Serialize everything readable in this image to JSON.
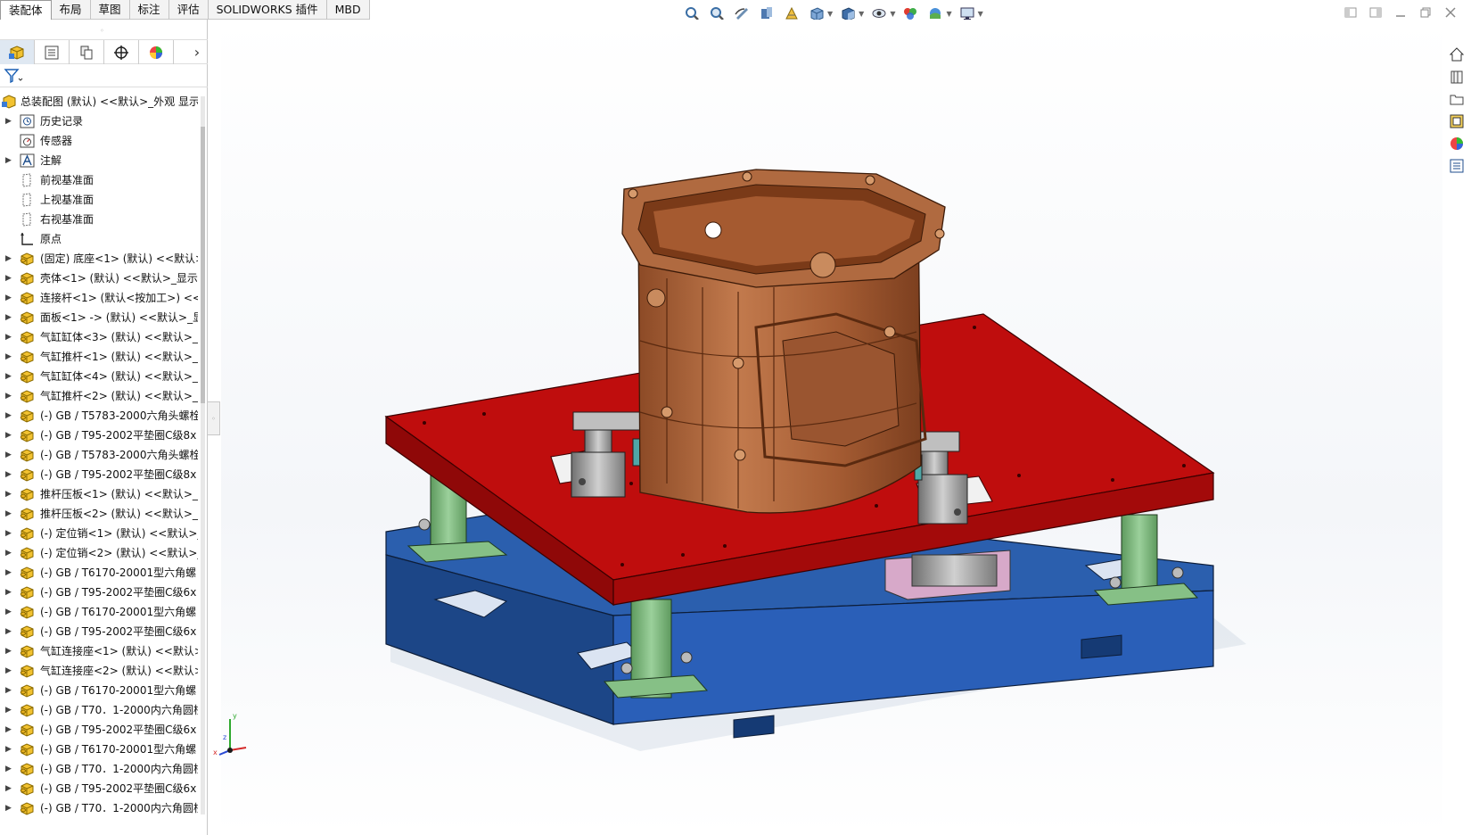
{
  "ribbon": {
    "tabs": [
      "装配体",
      "布局",
      "草图",
      "标注",
      "评估",
      "SOLIDWORKS 插件",
      "MBD"
    ],
    "active_tab": "装配体"
  },
  "heads_up_toolbar": {
    "icons": [
      "zoom-to-fit-icon",
      "zoom-to-area-icon",
      "previous-view-icon",
      "section-view-icon",
      "dynamic-annotation-icon",
      "view-orientation-icon",
      "display-style-icon",
      "hide-show-items-icon",
      "edit-appearance-icon",
      "apply-scene-icon",
      "view-settings-icon"
    ]
  },
  "window_controls": [
    "tile-left-icon",
    "tile-right-icon",
    "minimize-icon",
    "restore-icon",
    "close-icon"
  ],
  "feature_manager": {
    "panel_tabs": [
      "featuremanager-tree-icon",
      "propertymanager-icon",
      "configurationmanager-icon",
      "dimxpertmanager-icon",
      "displaymanager-icon"
    ],
    "root": "总装配图 (默认) <<默认>_外观 显示",
    "items": [
      {
        "label": "历史记录",
        "icon": "history-icon",
        "expandable": true
      },
      {
        "label": "传感器",
        "icon": "sensor-icon",
        "expandable": false
      },
      {
        "label": "注解",
        "icon": "annotation-icon",
        "expandable": true
      },
      {
        "label": "前视基准面",
        "icon": "plane-icon",
        "expandable": false
      },
      {
        "label": "上视基准面",
        "icon": "plane-icon",
        "expandable": false
      },
      {
        "label": "右视基准面",
        "icon": "plane-icon",
        "expandable": false
      },
      {
        "label": "原点",
        "icon": "origin-icon",
        "expandable": false
      },
      {
        "label": "(固定) 底座<1> (默认) <<默认>",
        "icon": "part-icon",
        "expandable": true
      },
      {
        "label": "壳体<1> (默认) <<默认>_显示",
        "icon": "part-icon",
        "expandable": true
      },
      {
        "label": "连接杆<1> (默认<按加工>) <<",
        "icon": "part-icon",
        "expandable": true
      },
      {
        "label": "面板<1> -> (默认) <<默认>_显",
        "icon": "part-icon",
        "expandable": true
      },
      {
        "label": "气缸缸体<3> (默认) <<默认>_显",
        "icon": "part-icon",
        "expandable": true
      },
      {
        "label": "气缸推杆<1> (默认) <<默认>_显",
        "icon": "part-icon",
        "expandable": true
      },
      {
        "label": "气缸缸体<4> (默认) <<默认>_显",
        "icon": "part-icon",
        "expandable": true
      },
      {
        "label": "气缸推杆<2> (默认) <<默认>_显",
        "icon": "part-icon",
        "expandable": true
      },
      {
        "label": "(-) GB / T5783-2000六角头螺栓",
        "icon": "part-icon",
        "expandable": true
      },
      {
        "label": "(-) GB / T95-2002平垫圈C级8x",
        "icon": "part-icon",
        "expandable": true
      },
      {
        "label": "(-) GB / T5783-2000六角头螺栓",
        "icon": "part-icon",
        "expandable": true
      },
      {
        "label": "(-) GB / T95-2002平垫圈C级8x",
        "icon": "part-icon",
        "expandable": true
      },
      {
        "label": "推杆压板<1> (默认) <<默认>_显",
        "icon": "part-icon",
        "expandable": true
      },
      {
        "label": "推杆压板<2> (默认) <<默认>_显",
        "icon": "part-icon",
        "expandable": true
      },
      {
        "label": "(-) 定位销<1> (默认) <<默认>_",
        "icon": "part-icon",
        "expandable": true
      },
      {
        "label": "(-) 定位销<2> (默认) <<默认>_",
        "icon": "part-icon",
        "expandable": true
      },
      {
        "label": "(-) GB / T6170-20001型六角螺",
        "icon": "part-icon",
        "expandable": true
      },
      {
        "label": "(-) GB / T95-2002平垫圈C级6x",
        "icon": "part-icon",
        "expandable": true
      },
      {
        "label": "(-) GB / T6170-20001型六角螺",
        "icon": "part-icon",
        "expandable": true
      },
      {
        "label": "(-) GB / T95-2002平垫圈C级6x",
        "icon": "part-icon",
        "expandable": true
      },
      {
        "label": "气缸连接座<1> (默认) <<默认>",
        "icon": "part-icon",
        "expandable": true
      },
      {
        "label": "气缸连接座<2> (默认) <<默认>",
        "icon": "part-icon",
        "expandable": true
      },
      {
        "label": "(-) GB / T6170-20001型六角螺",
        "icon": "part-icon",
        "expandable": true
      },
      {
        "label": "(-) GB / T70．1-2000内六角圆柱",
        "icon": "part-icon",
        "expandable": true
      },
      {
        "label": "(-) GB / T95-2002平垫圈C级6x",
        "icon": "part-icon",
        "expandable": true
      },
      {
        "label": "(-) GB / T6170-20001型六角螺",
        "icon": "part-icon",
        "expandable": true
      },
      {
        "label": "(-) GB / T70．1-2000内六角圆柱",
        "icon": "part-icon",
        "expandable": true
      },
      {
        "label": "(-) GB / T95-2002平垫圈C级6x",
        "icon": "part-icon",
        "expandable": true
      },
      {
        "label": "(-) GB / T70．1-2000内六角圆柱",
        "icon": "part-icon",
        "expandable": true
      }
    ]
  },
  "task_pane": [
    "solidworks-resources-icon",
    "design-library-icon",
    "file-explorer-icon",
    "view-palette-icon",
    "appearances-icon",
    "custom-properties-icon"
  ],
  "triad": {
    "x": "x",
    "y": "y",
    "z": "z"
  },
  "colors": {
    "top_plate": "#c00000",
    "base_plate": "#1f52a0",
    "pillars": "#7fb37f",
    "housing": "#b5663c",
    "cylinders": "#9a9a9a"
  }
}
